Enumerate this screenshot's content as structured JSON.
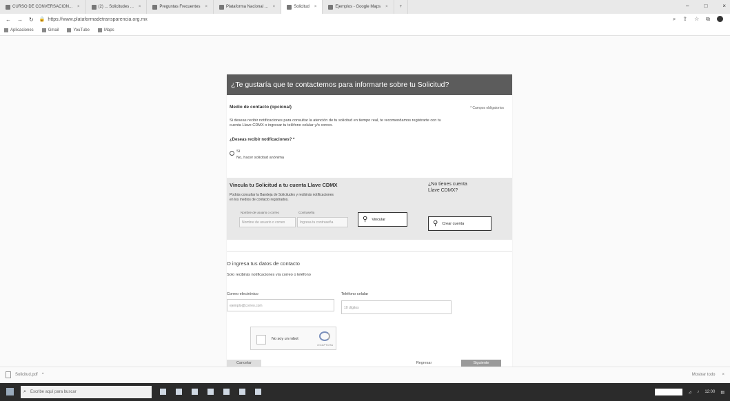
{
  "browser": {
    "tabs": [
      {
        "label": "CURSO DE CONVERSACION..."
      },
      {
        "label": "(2) ... Solicitudes ..."
      },
      {
        "label": "Preguntas Frecuentes"
      },
      {
        "label": "Plataforma Nacional ..."
      },
      {
        "label": "Solicitud"
      },
      {
        "label": "Ejemplos - Google Maps"
      }
    ],
    "new_tab": "+",
    "url": "https://www.plataformadetransparencia.org.mx",
    "window_controls": [
      "–",
      "□",
      "×"
    ],
    "bookmarks": [
      "Aplicaciones",
      "Gmail",
      "YouTube",
      "Maps"
    ]
  },
  "form": {
    "header_title": "¿Te gustaría que te contactemos para informarte sobre tu Solicitud?",
    "contact_section_title": "Medio de contacto (opcional)",
    "required_note": "* Campos obligatorios",
    "intro_text_line1": "Si deseas recibir notificaciones para consultar la atención de tu solicitud en tiempo real, te recomendamos registrarte con tu",
    "intro_text_line2": "cuenta Llave CDMX o ingresar tu teléfono celular y/o correo.",
    "notify_question": "¿Deseas recibir notificaciones? *",
    "radio_yes": "Sí",
    "radio_no": "No, hacer solicitud anónima",
    "llave_title": "Vincula tu Solicitud a tu cuenta Llave CDMX",
    "llave_desc_line1": "Podrás consultar la Bandeja de Solicitudes y recibirás notificaciones",
    "llave_desc_line2": "en los medios de contacto registrados.",
    "llave_user_label": "Nombre de usuario o correo",
    "llave_user_placeholder": "Nombre de usuario o correo",
    "llave_pass_label": "Contraseña",
    "llave_pass_placeholder": "Ingresa tu contraseña",
    "link_button": "Vincular",
    "no_account_title_line1": "¿No tienes cuenta",
    "no_account_title_line2": "Llave CDMX?",
    "register_button": "Crear cuenta",
    "alt_title": "O ingresa tus datos de contacto",
    "alt_desc": "Solo recibirás notificaciones vía correo o teléfono",
    "email_label": "Correo electrónico",
    "email_placeholder": "ejemplo@correo.com",
    "phone_label": "Teléfono celular",
    "phone_placeholder": "10 dígitos",
    "recaptcha_label": "No soy un robot",
    "recaptcha_brand": "reCAPTCHA",
    "cancel_button": "Cancelar",
    "back_button": "Regresar",
    "next_button": "Siguiente"
  },
  "downloads": {
    "file_label": "Solicitud.pdf",
    "chevron": "^",
    "show_all": "Mostrar todo",
    "close": "×"
  },
  "taskbar": {
    "search_placeholder": "Escribe aquí para buscar",
    "time": "12:00"
  }
}
